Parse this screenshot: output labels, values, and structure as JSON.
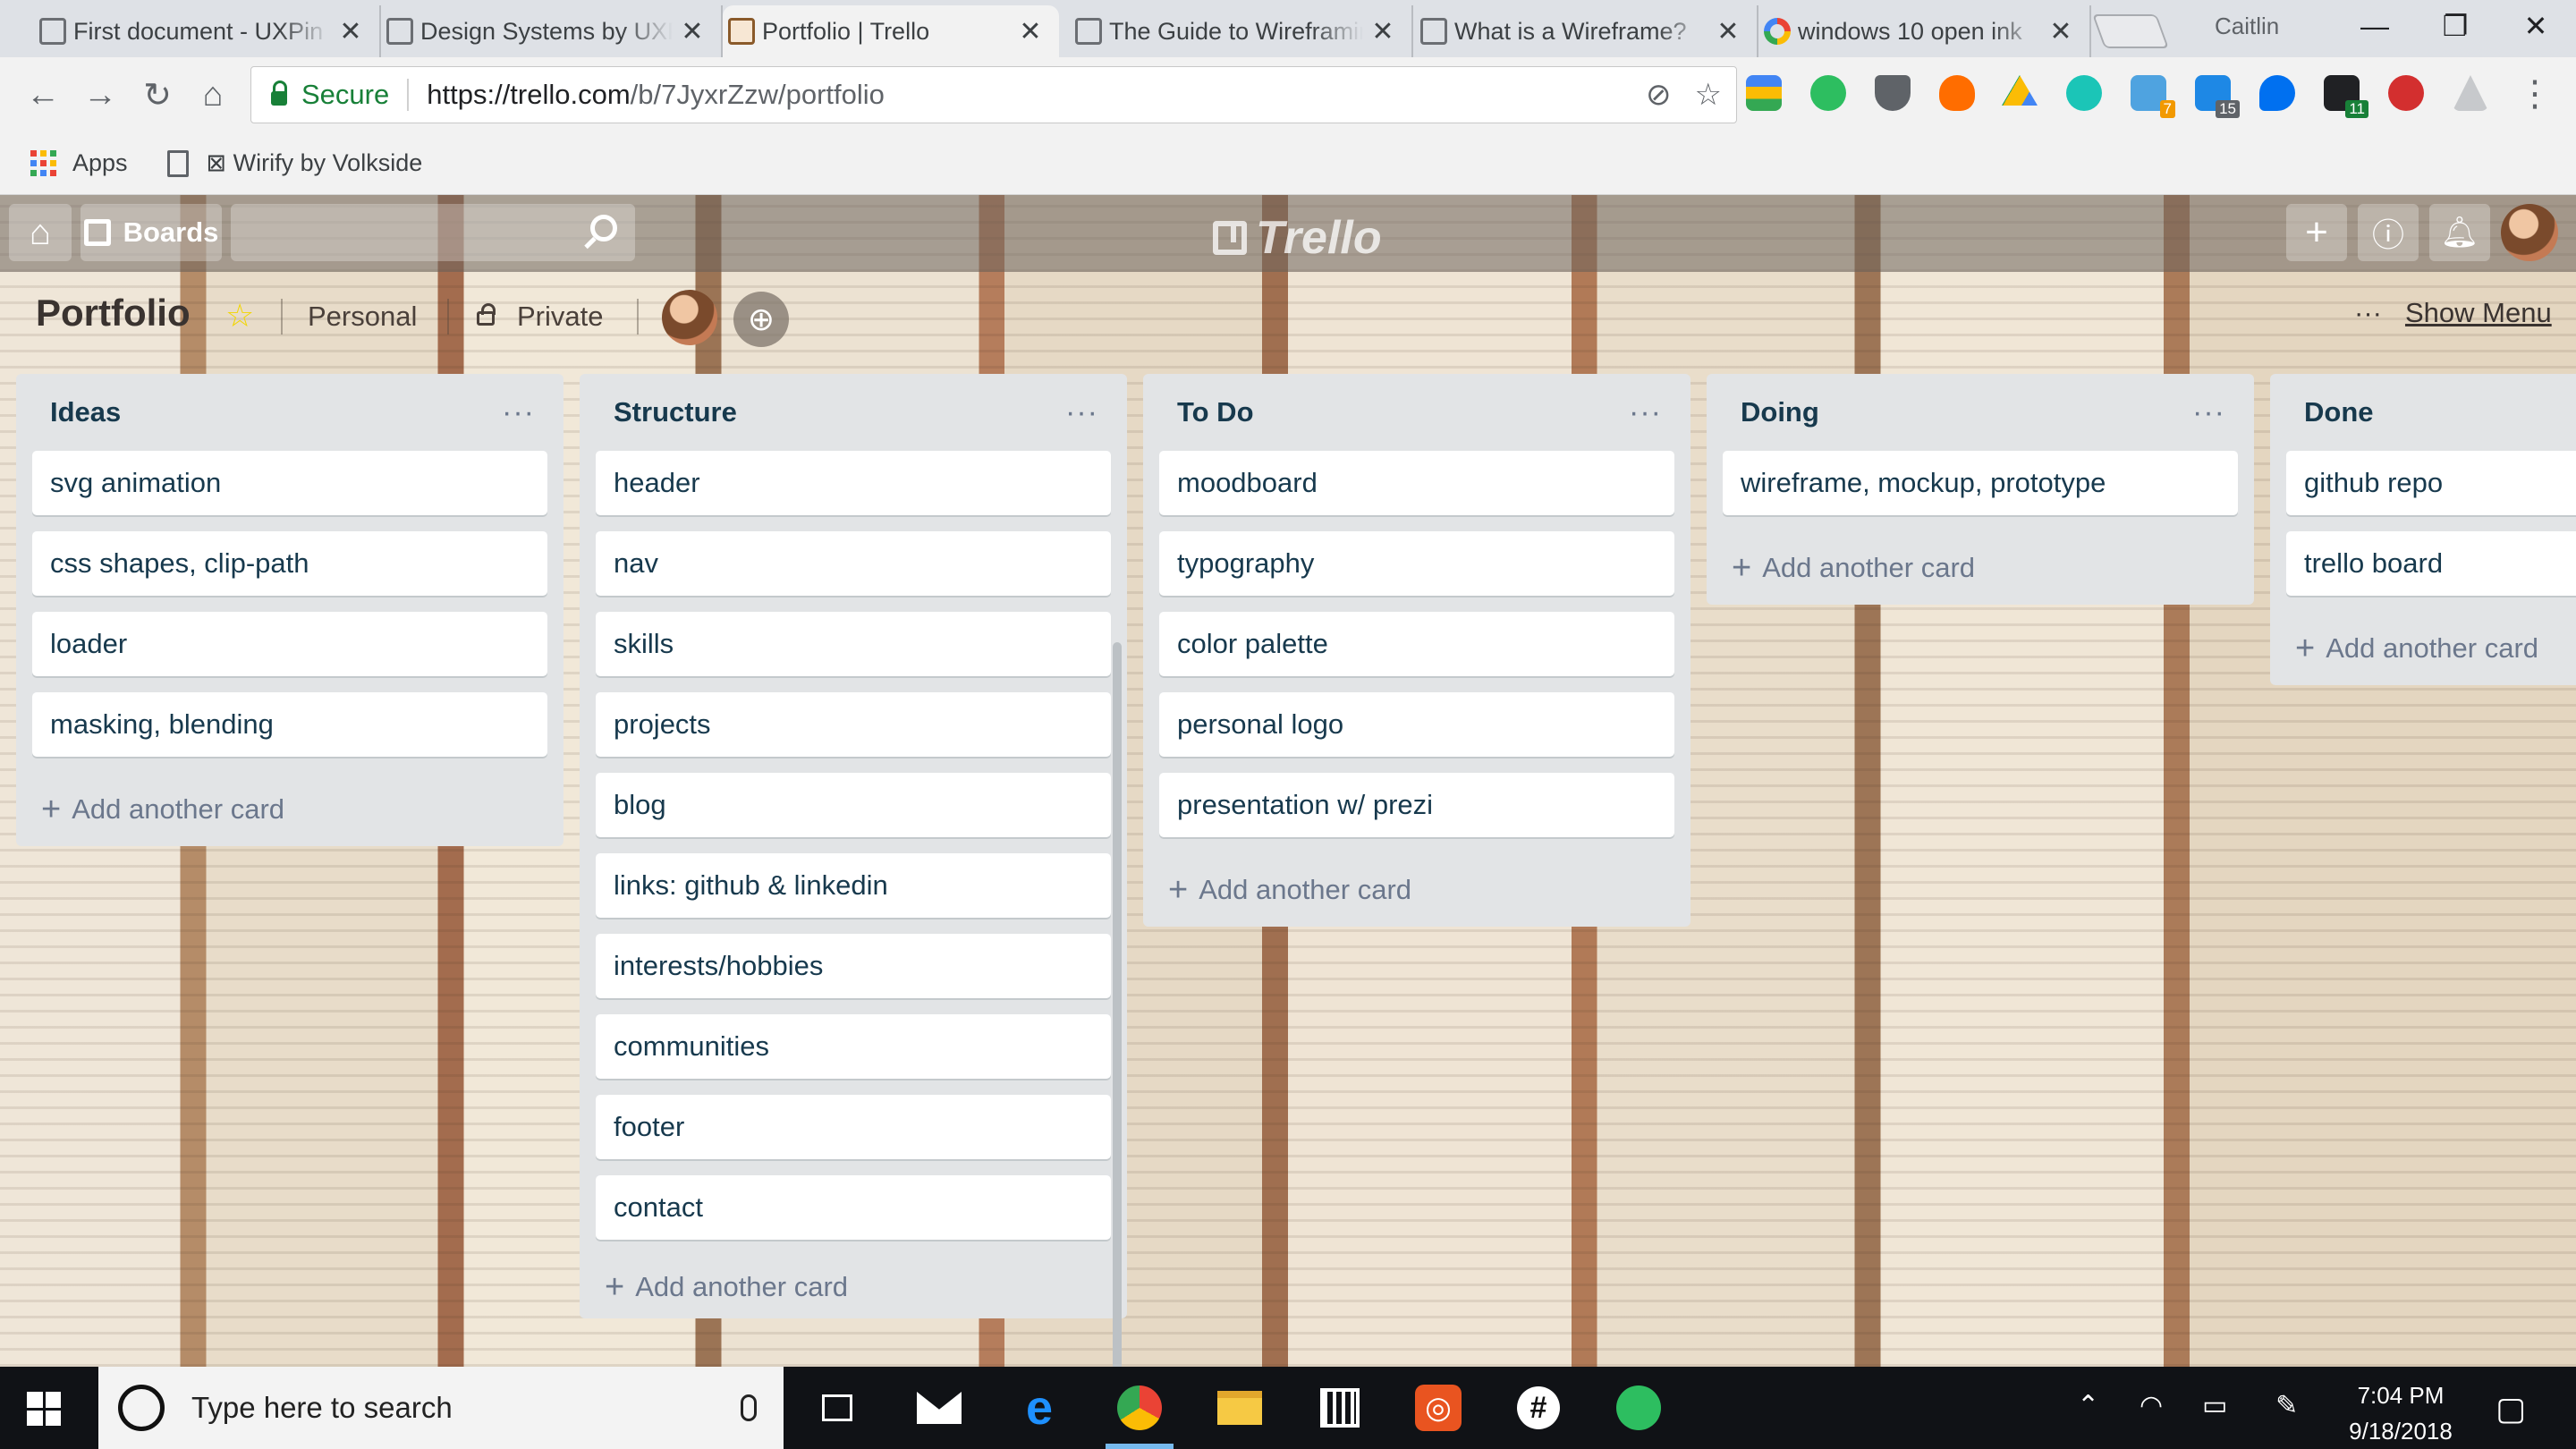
{
  "browser": {
    "tabs": [
      {
        "title": "First document - UXPin",
        "active": false,
        "favicon": "page-icon"
      },
      {
        "title": "Design Systems by UXPin",
        "active": false,
        "favicon": "page-icon"
      },
      {
        "title": "Portfolio | Trello",
        "active": true,
        "favicon": "trello-icon"
      },
      {
        "title": "The Guide to Wireframing",
        "active": false,
        "favicon": "page-icon"
      },
      {
        "title": "What is a Wireframe?",
        "active": false,
        "favicon": "page-icon"
      },
      {
        "title": "windows 10 open ink",
        "active": false,
        "favicon": "google-icon"
      }
    ],
    "close_glyph": "✕",
    "profile_name": "Caitlin",
    "address": {
      "secure_label": "Secure",
      "url_host": "https://trello.com",
      "url_path": "/b/7JyxrZzw/portfolio"
    },
    "extension_badges": {
      "ext1": "7",
      "ext2": "15",
      "ext3": "11"
    },
    "bookmarks": {
      "apps": "Apps",
      "wirify": "⊠ Wirify by Volkside"
    }
  },
  "board": {
    "header": {
      "boards_label": "Boards",
      "logo_text": "Trello"
    },
    "title": "Portfolio",
    "team": "Personal",
    "visibility": "Private",
    "show_menu": "Show Menu",
    "lists": [
      {
        "title": "Ideas",
        "cards": [
          "svg animation",
          "css shapes, clip-path",
          "loader",
          "masking, blending"
        ],
        "add_label": "Add another card"
      },
      {
        "title": "Structure",
        "cards": [
          "header",
          "nav",
          "skills",
          "projects",
          "blog",
          "links: github & linkedin",
          "interests/hobbies",
          "communities",
          "footer",
          "contact"
        ],
        "add_label": "Add another card"
      },
      {
        "title": "To Do",
        "cards": [
          "moodboard",
          "typography",
          "color palette",
          "personal logo",
          "presentation w/ prezi"
        ],
        "add_label": "Add another card"
      },
      {
        "title": "Doing",
        "cards": [
          "wireframe, mockup, prototype"
        ],
        "add_label": "Add another card"
      },
      {
        "title": "Done",
        "cards": [
          "github repo",
          "trello board"
        ],
        "add_label": "Add another card"
      }
    ]
  },
  "taskbar": {
    "search_placeholder": "Type here to search",
    "time": "7:04 PM",
    "date": "9/18/2018"
  },
  "colors": {
    "trello_list_bg": "#e2e4e6",
    "card_text": "#17394d",
    "secure_green": "#188038",
    "star_yellow": "#f2d600"
  }
}
